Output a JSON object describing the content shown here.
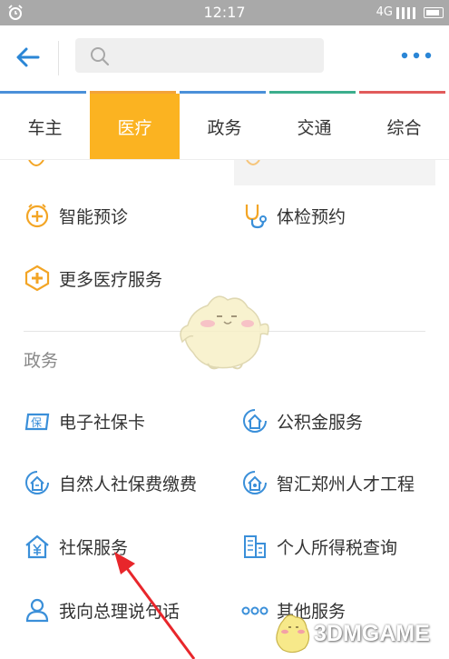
{
  "status_bar": {
    "time": "12:17",
    "network": "4G"
  },
  "search": {
    "placeholder": ""
  },
  "category_strip_colors": [
    "#4a90d9",
    "#f2a33a",
    "#4a90d9",
    "#3cae8d",
    "#e15b5b"
  ],
  "tabs": [
    {
      "label": "车主",
      "active": false
    },
    {
      "label": "医疗",
      "active": true
    },
    {
      "label": "政务",
      "active": false
    },
    {
      "label": "交通",
      "active": false
    },
    {
      "label": "综合",
      "active": false
    }
  ],
  "medical_services": [
    {
      "label": "智能预诊",
      "icon": "clock-cross-icon"
    },
    {
      "label": "体检预约",
      "icon": "stethoscope-icon"
    },
    {
      "label": "更多医疗服务",
      "icon": "medical-cross-icon"
    }
  ],
  "gov_section": {
    "title": "政务",
    "items": [
      {
        "label": "电子社保卡",
        "icon": "social-security-card-icon"
      },
      {
        "label": "公积金服务",
        "icon": "housing-fund-icon"
      },
      {
        "label": "自然人社保费缴费",
        "icon": "social-fee-icon"
      },
      {
        "label": "智汇郑州人才工程",
        "icon": "talent-project-icon"
      },
      {
        "label": "社保服务",
        "icon": "house-yuan-icon"
      },
      {
        "label": "个人所得税查询",
        "icon": "tax-building-icon"
      },
      {
        "label": "我向总理说句话",
        "icon": "person-icon"
      },
      {
        "label": "其他服务",
        "icon": "three-dots-icon"
      }
    ]
  },
  "colors": {
    "accent_orange": "#fbb321",
    "icon_blue": "#3a8fd9",
    "icon_orange": "#f3a525",
    "annotation_red": "#e8262b"
  },
  "watermark": {
    "text": "3DMGAME"
  }
}
